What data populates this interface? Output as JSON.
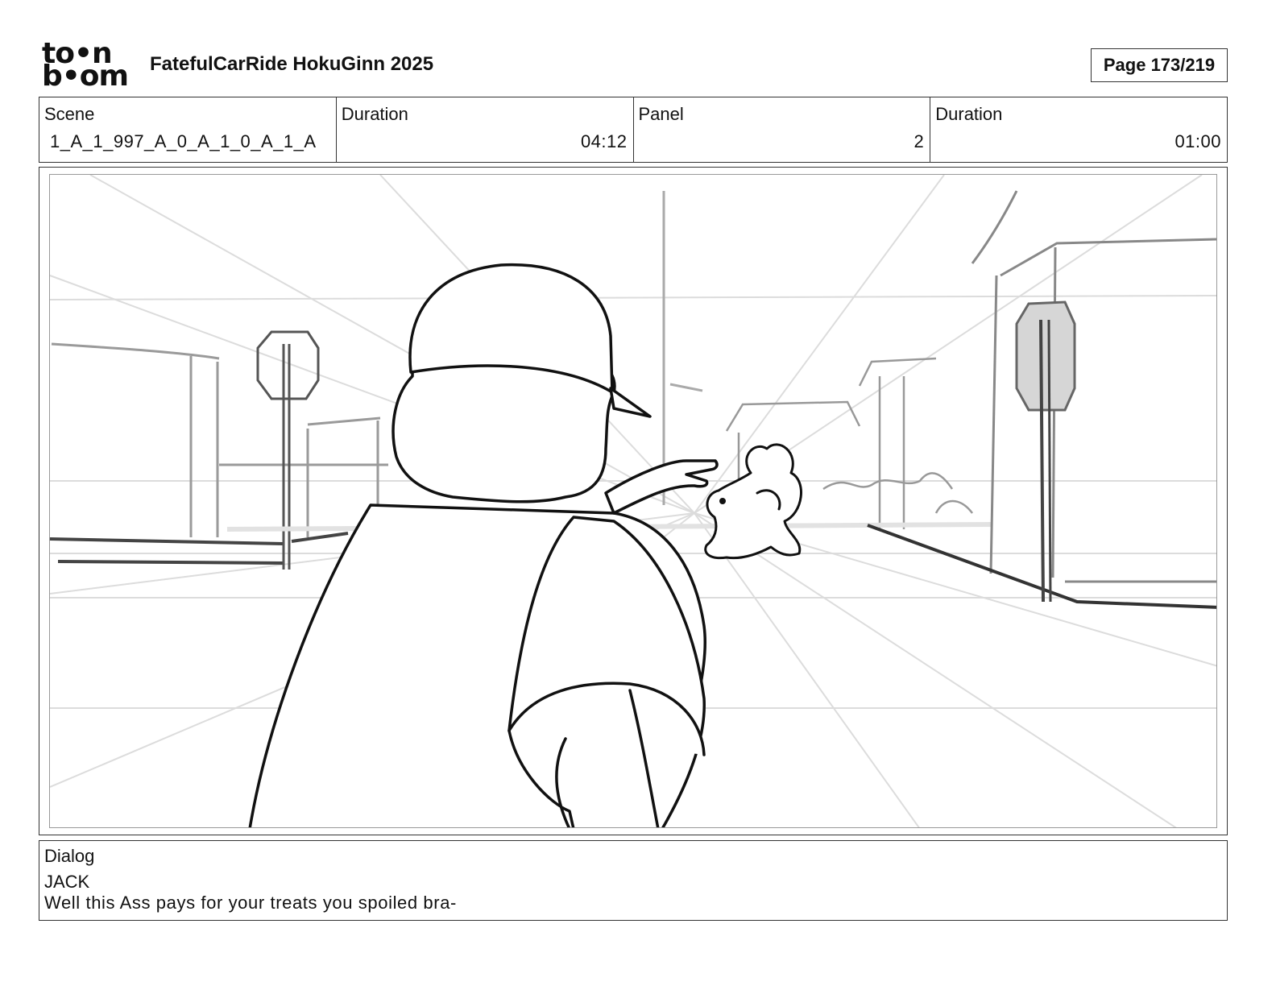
{
  "header": {
    "logo_top": "to•n",
    "logo_bottom": "b•om",
    "project_title": "FatefulCarRide HokuGinn 2025",
    "page": "Page 173/219"
  },
  "info": {
    "scene_label": "Scene",
    "scene_value": "1_A_1_997_A_0_A_1_0_A_1_A",
    "scene_duration_label": "Duration",
    "scene_duration_value": "04:12",
    "panel_label": "Panel",
    "panel_value": "2",
    "panel_duration_label": "Duration",
    "panel_duration_value": "01:00"
  },
  "dialog": {
    "label": "Dialog",
    "speaker": "JACK",
    "line": "Well this Ass pays for your treats you spoiled bra-"
  }
}
